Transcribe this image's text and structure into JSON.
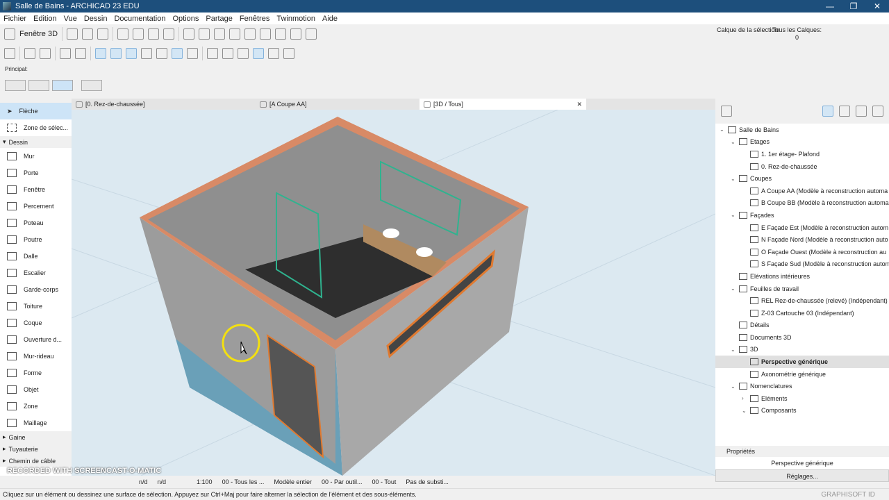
{
  "window": {
    "title": "Salle de Bains - ARCHICAD 23 EDU"
  },
  "menu": [
    "Fichier",
    "Edition",
    "Vue",
    "Dessin",
    "Documentation",
    "Options",
    "Partage",
    "Fenêtres",
    "Twinmotion",
    "Aide"
  ],
  "toolbar": {
    "window_3d": "Fenêtre 3D",
    "calque_label": "Calque de la sélection:",
    "tous_calques": "Tous les Calques:",
    "tous_calques_value": "0"
  },
  "principal_label": "Principal:",
  "tabs": [
    {
      "label": "[0. Rez-de-chaussée]"
    },
    {
      "label": "[A Coupe AA]"
    },
    {
      "label": "[3D / Tous]"
    }
  ],
  "toolbox": {
    "top": [
      {
        "label": "Flèche"
      },
      {
        "label": "Zone de sélec..."
      }
    ],
    "group_dessin": "Dessin",
    "tools": [
      "Mur",
      "Porte",
      "Fenêtre",
      "Percement",
      "Poteau",
      "Poutre",
      "Dalle",
      "Escalier",
      "Garde-corps",
      "Toiture",
      "Coque",
      "Ouverture d...",
      "Mur-rideau",
      "Forme",
      "Objet",
      "Zone",
      "Maillage"
    ],
    "groups": [
      "Gaine",
      "Tuyauterie",
      "Chemin de câble"
    ]
  },
  "navigator": {
    "items": [
      {
        "label": "Salle de Bains",
        "level": 0,
        "chev": "⌄"
      },
      {
        "label": "Etages",
        "level": 1,
        "chev": "⌄"
      },
      {
        "label": "1. 1er étage- Plafond",
        "level": 2
      },
      {
        "label": "0. Rez-de-chaussée",
        "level": 2
      },
      {
        "label": "Coupes",
        "level": 1,
        "chev": "⌄"
      },
      {
        "label": "A Coupe AA (Modèle à reconstruction automa",
        "level": 2
      },
      {
        "label": "B Coupe BB (Modèle à reconstruction automa",
        "level": 2
      },
      {
        "label": "Façades",
        "level": 1,
        "chev": "⌄"
      },
      {
        "label": "E Façade Est (Modèle à reconstruction autom",
        "level": 2
      },
      {
        "label": "N Façade Nord (Modèle à reconstruction auto",
        "level": 2
      },
      {
        "label": "O Façade Ouest (Modèle à reconstruction au",
        "level": 2
      },
      {
        "label": "S Façade Sud (Modèle à reconstruction autom",
        "level": 2
      },
      {
        "label": "Elévations intérieures",
        "level": 1
      },
      {
        "label": "Feuilles de travail",
        "level": 1,
        "chev": "⌄"
      },
      {
        "label": "REL Rez-de-chaussée (relevé) (Indépendant)",
        "level": 2
      },
      {
        "label": "Z-03 Cartouche 03 (Indépendant)",
        "level": 2
      },
      {
        "label": "Détails",
        "level": 1
      },
      {
        "label": "Documents 3D",
        "level": 1
      },
      {
        "label": "3D",
        "level": 1,
        "chev": "⌄"
      },
      {
        "label": "Perspective générique",
        "level": 2,
        "selected": true
      },
      {
        "label": "Axonométrie générique",
        "level": 2
      },
      {
        "label": "Nomenclatures",
        "level": 1,
        "chev": "⌄"
      },
      {
        "label": "Eléments",
        "level": 2,
        "chev": "›"
      },
      {
        "label": "Composants",
        "level": 2,
        "chev": "⌄"
      }
    ]
  },
  "properties": {
    "title": "Propriétés",
    "view": "Perspective générique",
    "settings": "Réglages..."
  },
  "status": {
    "undo": "n/d",
    "redo": "n/d",
    "scale": "1:100",
    "layers": "00 - Tous les ...",
    "model": "Modèle entier",
    "pen": "00 - Par outil...",
    "mvo": "00 - Tout",
    "renovation": "Pas de substi..."
  },
  "message": "Cliquez sur un élément ou dessinez une surface de sélection. Appuyez sur Ctrl+Maj pour faire alterner la sélection de l'élément et des sous-éléments.",
  "graphisoft": "GRAPHISOFT ID",
  "watermark": "RECORDED WITH SCREENCAST-O-MATIC"
}
